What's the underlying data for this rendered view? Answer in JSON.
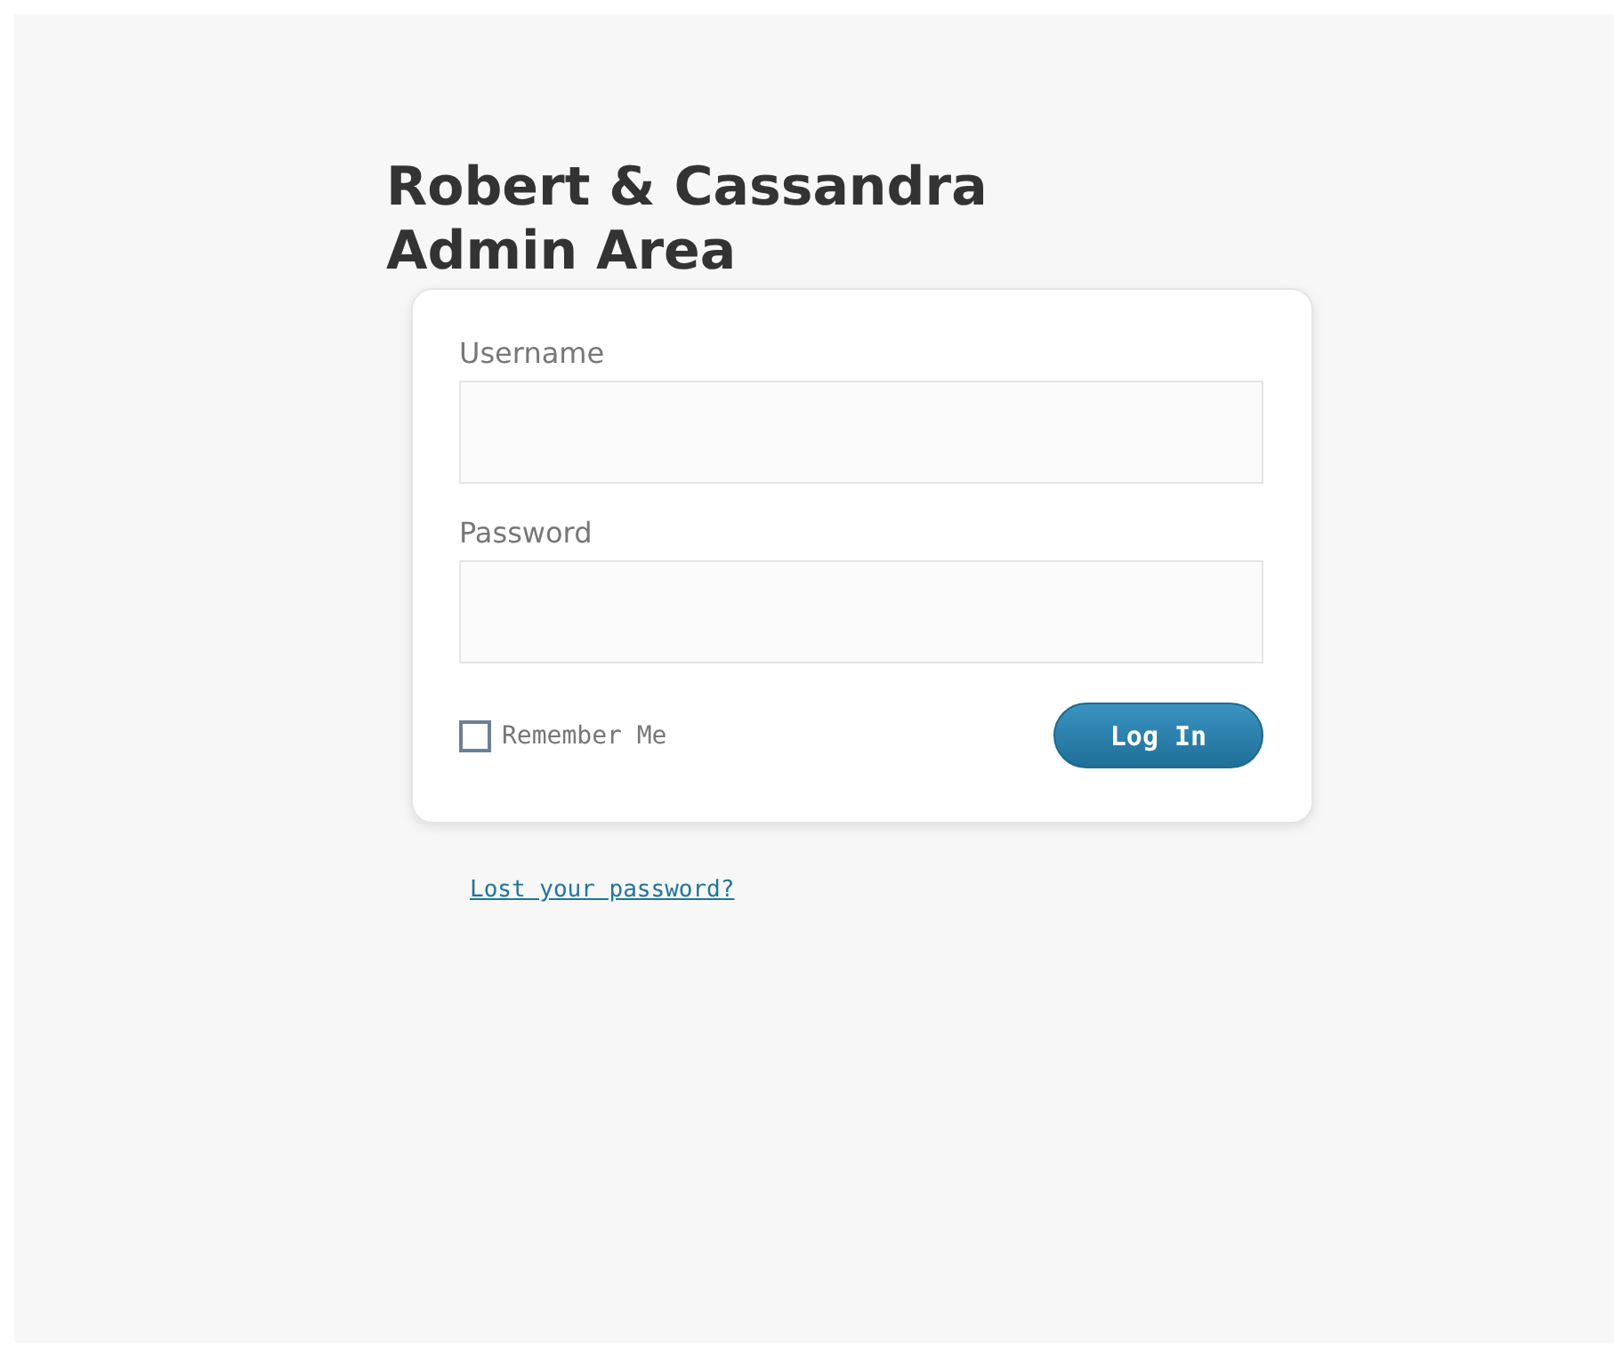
{
  "title": "Robert & Cassandra Admin Area",
  "form": {
    "fields": [
      {
        "label": "Username"
      },
      {
        "label": "Password"
      }
    ],
    "remember": {
      "label": "Remember Me",
      "checked": false
    },
    "submit": "Log In"
  },
  "lost_password_link": "Lost your password?"
}
